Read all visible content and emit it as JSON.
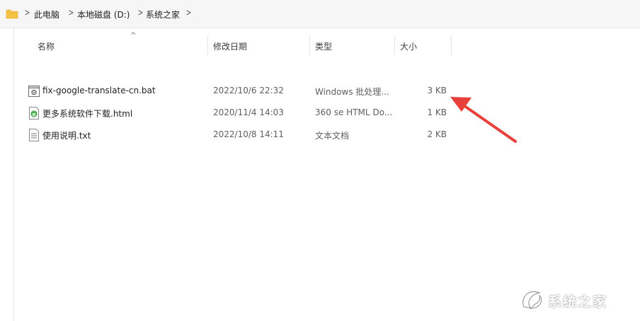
{
  "breadcrumb": {
    "items": [
      "此电脑",
      "本地磁盘 (D:)",
      "系统之家"
    ]
  },
  "columns": {
    "name": "名称",
    "date": "修改日期",
    "type": "类型",
    "size": "大小"
  },
  "files": [
    {
      "name": "fix-google-translate-cn.bat",
      "date": "2022/10/6 22:32",
      "type": "Windows 批处理...",
      "size": "3 KB",
      "icon": "batch-file-icon"
    },
    {
      "name": "更多系统软件下载.html",
      "date": "2020/11/4 14:03",
      "type": "360 se HTML Do...",
      "size": "1 KB",
      "icon": "html-file-icon"
    },
    {
      "name": "使用说明.txt",
      "date": "2022/10/8 14:11",
      "type": "文本文档",
      "size": "2 KB",
      "icon": "text-file-icon"
    }
  ],
  "annotation": {
    "color": "#e8403a",
    "target": "fix-google-translate-cn.bat size"
  },
  "watermark": {
    "text": "系统之家"
  },
  "colors": {
    "folder": "#f5c343",
    "arrow": "#e8403a",
    "html_icon": "#4caf50"
  }
}
